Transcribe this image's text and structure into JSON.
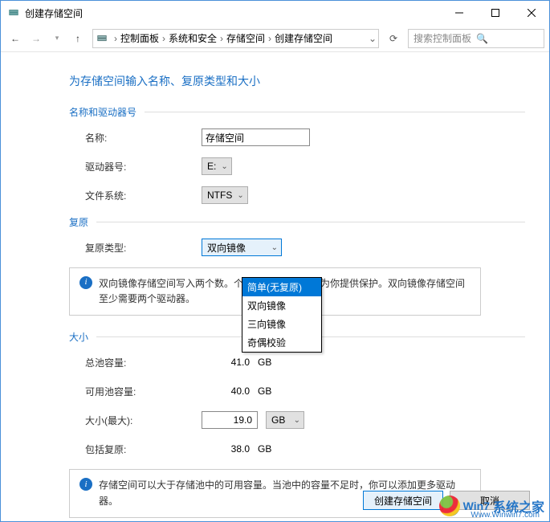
{
  "window": {
    "title": "创建存储空间"
  },
  "nav": {
    "breadcrumb": [
      "控制面板",
      "系统和安全",
      "存储空间",
      "创建存储空间"
    ],
    "search_placeholder": "搜索控制面板"
  },
  "page": {
    "heading": "为存储空间输入名称、复原类型和大小",
    "sections": {
      "name_drive": {
        "title": "名称和驱动器号",
        "name_label": "名称:",
        "name_value": "存储空间",
        "drive_label": "驱动器号:",
        "drive_value": "E:",
        "fs_label": "文件系统:",
        "fs_value": "NTFS"
      },
      "resiliency": {
        "title": "复原",
        "type_label": "复原类型:",
        "type_value": "双向镜像",
        "options": [
          "简单(无复原)",
          "双向镜像",
          "三向镜像",
          "奇偶校验"
        ],
        "info_text": "双向镜像存储空间写入两个数。个驱动器发生故障时为你提供保护。双向镜像存储空间至少需要两个驱动器。"
      },
      "size": {
        "title": "大小",
        "total_label": "总池容量:",
        "total_value": "41.0",
        "total_unit": "GB",
        "avail_label": "可用池容量:",
        "avail_value": "40.0",
        "avail_unit": "GB",
        "max_label": "大小(最大):",
        "max_value": "19.0",
        "max_unit": "GB",
        "incl_label": "包括复原:",
        "incl_value": "38.0",
        "incl_unit": "GB",
        "info_text": "存储空间可以大于存储池中的可用容量。当池中的容量不足时，你可以添加更多驱动器。"
      }
    },
    "buttons": {
      "create": "创建存储空间",
      "cancel": "取消"
    }
  },
  "watermark": {
    "brand": "Win7",
    "cn": "系统之家",
    "url": "Www.Winwin7.com"
  }
}
